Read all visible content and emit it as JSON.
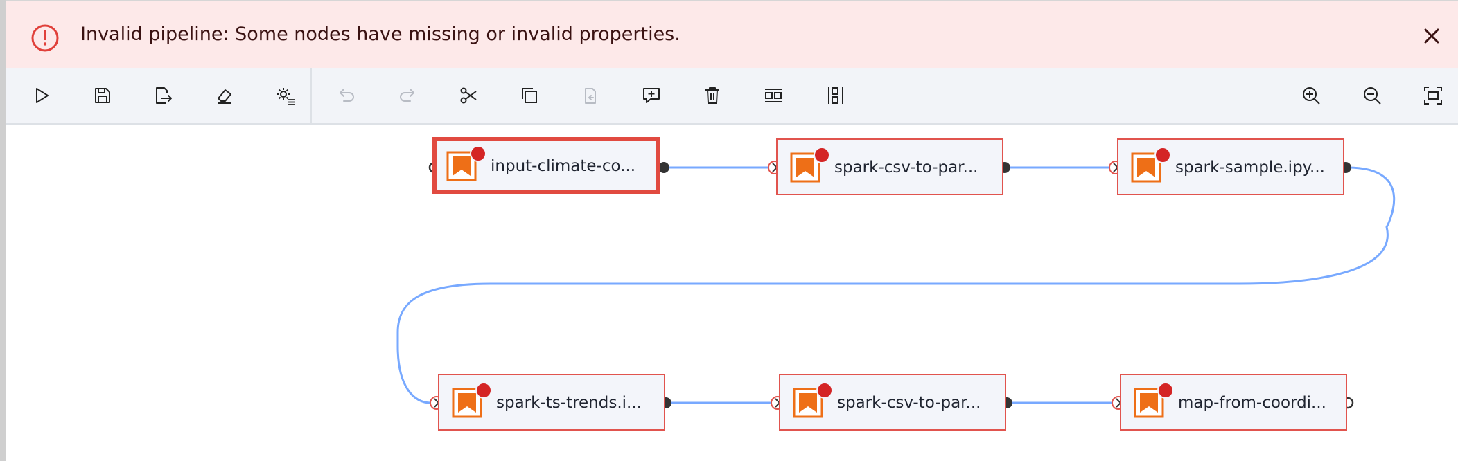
{
  "banner": {
    "message": "Invalid pipeline: Some nodes have missing or invalid properties.",
    "icon": "error-circle-icon",
    "close_icon": "close-icon",
    "colors": {
      "background": "#fde9e9",
      "icon": "#e0403a",
      "text": "#3a1212"
    }
  },
  "toolbar": {
    "left_actions": [
      {
        "id": "run",
        "icon": "play-icon",
        "enabled": true
      },
      {
        "id": "save",
        "icon": "save-icon",
        "enabled": true
      },
      {
        "id": "export",
        "icon": "export-icon",
        "enabled": true
      },
      {
        "id": "clear",
        "icon": "eraser-icon",
        "enabled": true
      },
      {
        "id": "runtimes",
        "icon": "settings-list-icon",
        "enabled": true
      }
    ],
    "edit_actions": [
      {
        "id": "undo",
        "icon": "undo-icon",
        "enabled": false
      },
      {
        "id": "redo",
        "icon": "redo-icon",
        "enabled": false
      },
      {
        "id": "cut",
        "icon": "cut-icon",
        "enabled": true
      },
      {
        "id": "copy",
        "icon": "copy-icon",
        "enabled": true
      },
      {
        "id": "paste",
        "icon": "paste-icon",
        "enabled": false
      },
      {
        "id": "add-comment",
        "icon": "add-comment-icon",
        "enabled": true
      },
      {
        "id": "delete",
        "icon": "trash-icon",
        "enabled": true
      },
      {
        "id": "arrange-horizontal",
        "icon": "arrange-horizontal-icon",
        "enabled": true
      },
      {
        "id": "arrange-vertical",
        "icon": "arrange-vertical-icon",
        "enabled": true
      }
    ],
    "view_actions": [
      {
        "id": "zoom-in",
        "icon": "zoom-in-icon",
        "enabled": true
      },
      {
        "id": "zoom-out",
        "icon": "zoom-out-icon",
        "enabled": true
      },
      {
        "id": "fit-to-screen",
        "icon": "fit-to-screen-icon",
        "enabled": true
      }
    ]
  },
  "pipeline": {
    "nodes": [
      {
        "id": "n1",
        "label": "input-climate-co...",
        "selected": true,
        "has_error": true
      },
      {
        "id": "n2",
        "label": "spark-csv-to-par...",
        "selected": false,
        "has_error": true
      },
      {
        "id": "n3",
        "label": "spark-sample.ipy...",
        "selected": false,
        "has_error": true
      },
      {
        "id": "n4",
        "label": "spark-ts-trends.i...",
        "selected": false,
        "has_error": true
      },
      {
        "id": "n5",
        "label": "spark-csv-to-par...",
        "selected": false,
        "has_error": true
      },
      {
        "id": "n6",
        "label": "map-from-coordi...",
        "selected": false,
        "has_error": true
      }
    ],
    "links": [
      [
        "n1",
        "n2"
      ],
      [
        "n2",
        "n3"
      ],
      [
        "n3",
        "n4"
      ],
      [
        "n4",
        "n5"
      ],
      [
        "n5",
        "n6"
      ]
    ],
    "node_icon": "notebook-bookmark-icon",
    "colors": {
      "node_border": "#e1544e",
      "node_bg": "#f3f5fa",
      "error_dot": "#d42525",
      "link": "#78a9ff",
      "icon": "#ee6f17",
      "port": "#333333"
    }
  }
}
